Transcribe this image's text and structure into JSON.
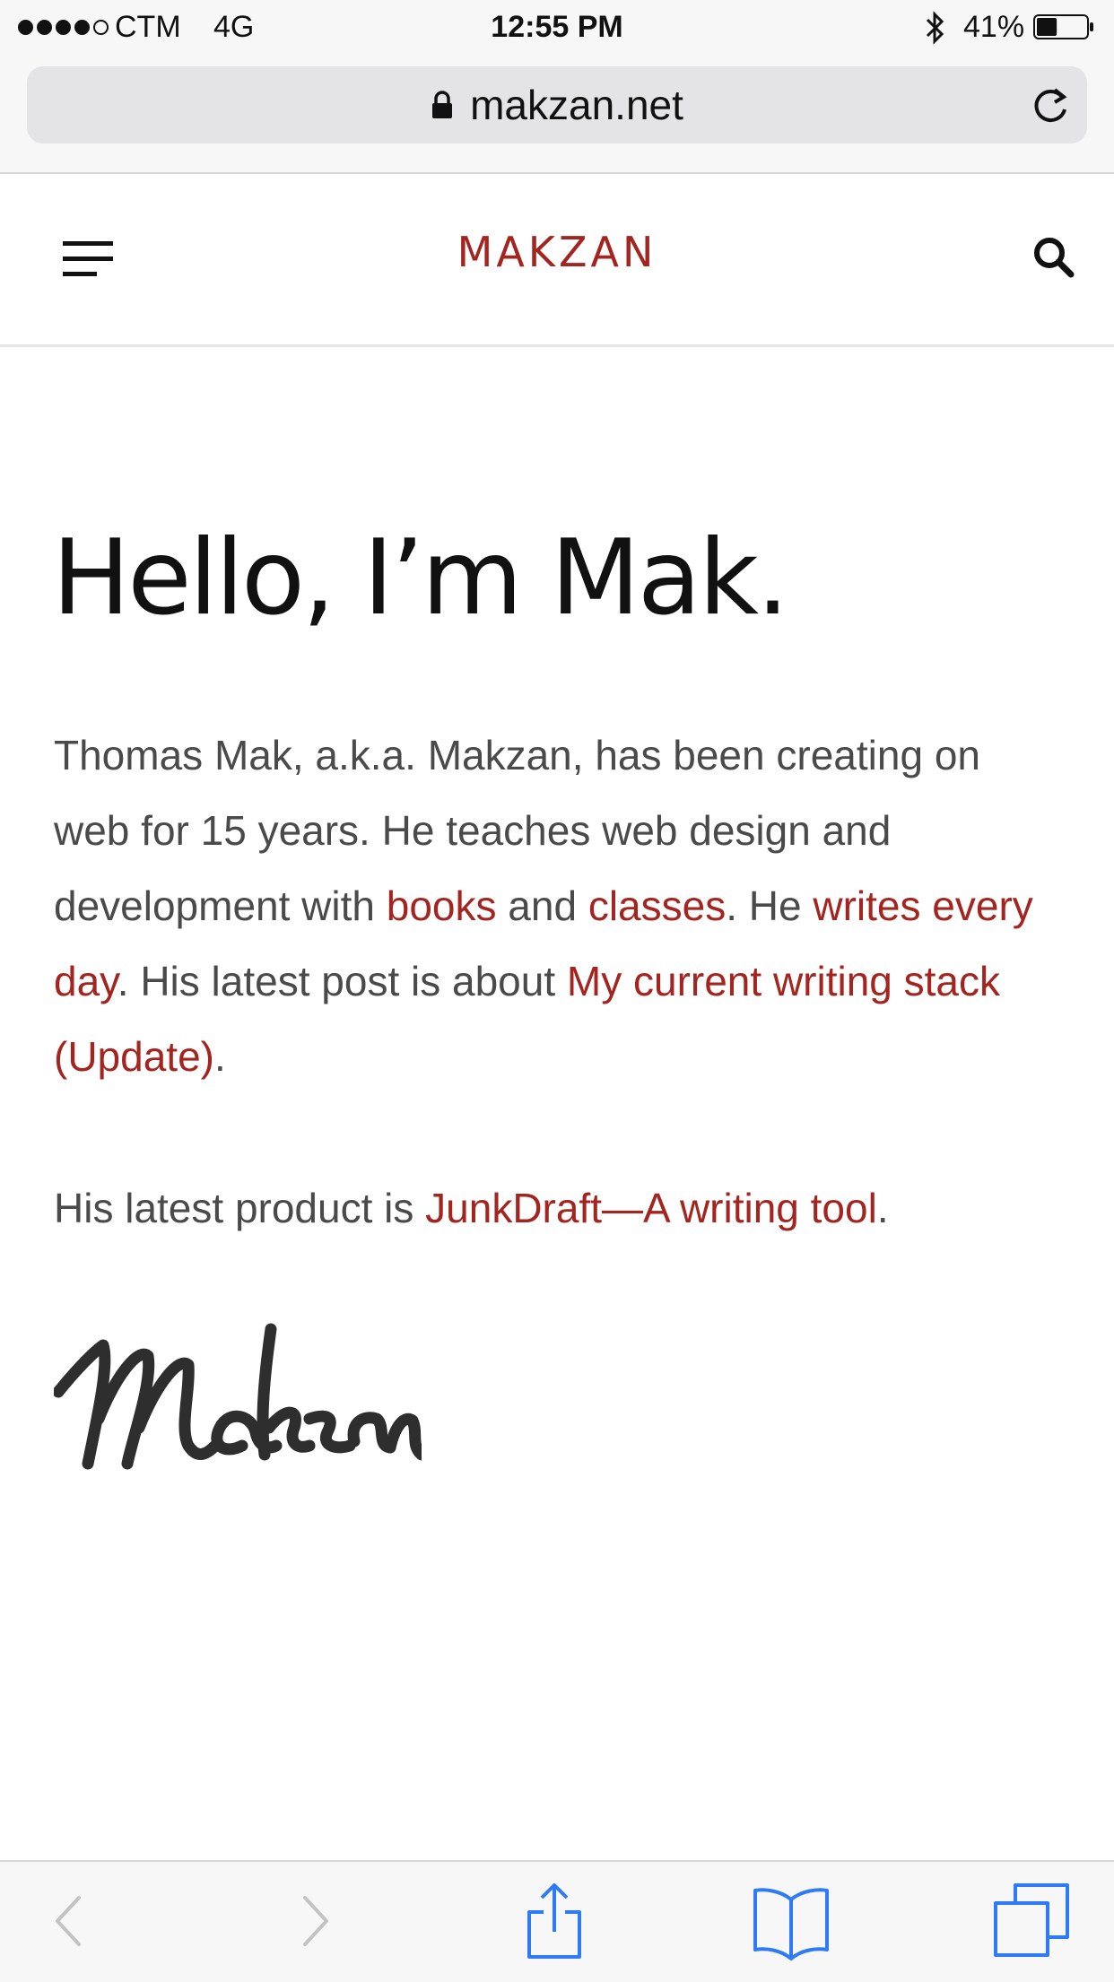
{
  "status_bar": {
    "carrier": "CTM",
    "network": "4G",
    "time": "12:55 PM",
    "battery": "41%",
    "battery_level": 0.41
  },
  "browser": {
    "url": "makzan.net"
  },
  "site": {
    "title": "MAKZAN"
  },
  "content": {
    "heading": "Hello, I’m Mak.",
    "para1": {
      "t1": "Thomas Mak, a.k.a. Makzan, has been creating on web for 15 years. He teaches web design and development with ",
      "link_books": "books",
      "t2": " and ",
      "link_classes": "classes",
      "t3": ". He ",
      "link_writes": "writes every day",
      "t4": ". His latest post is about ",
      "link_post": "My current writing stack (Update)",
      "t5": "."
    },
    "para2": {
      "t1": "His latest product is ",
      "link_product": "JunkDraft—A writing tool",
      "t2": "."
    },
    "signature_text": "Makzan"
  },
  "icons": {
    "menu": "hamburger-icon",
    "search": "search-icon",
    "lock": "lock-icon",
    "reload": "reload-icon",
    "back": "back-icon",
    "forward": "forward-icon",
    "share": "share-icon",
    "bookmarks": "bookmarks-icon",
    "tabs": "tabs-icon"
  },
  "colors": {
    "accent": "#a42420",
    "toolbar_icon": "#2f7bf5",
    "toolbar_icon_disabled": "#c3c3c3"
  }
}
